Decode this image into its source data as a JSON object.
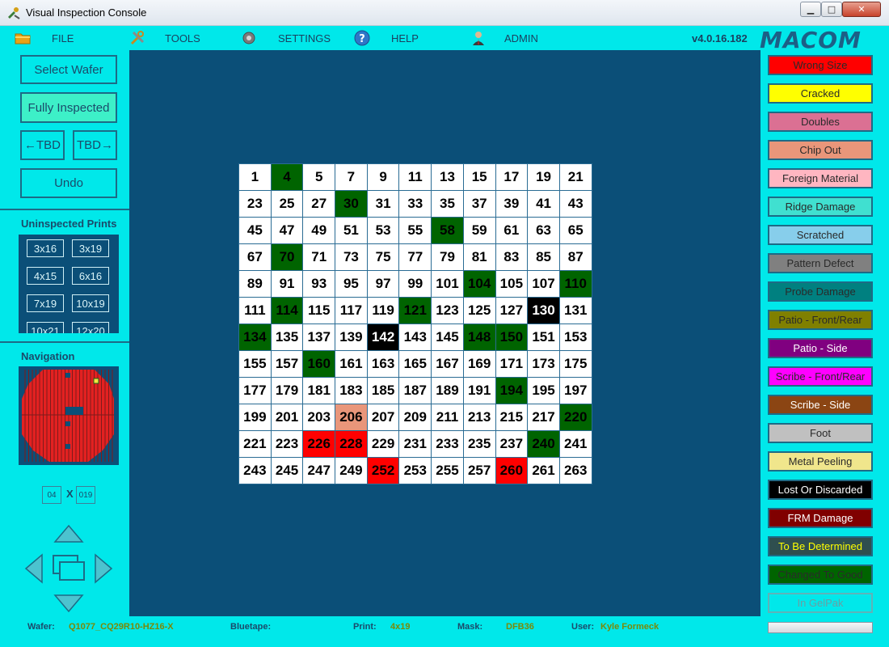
{
  "window": {
    "title": "Visual Inspection Console",
    "controls": {
      "minimize": "▁",
      "maximize": "□",
      "close": "✕"
    }
  },
  "menu": {
    "items": [
      {
        "label": "FILE",
        "icon": "folder-icon"
      },
      {
        "label": "TOOLS",
        "icon": "tools-icon"
      },
      {
        "label": "SETTINGS",
        "icon": "settings-icon"
      },
      {
        "label": "HELP",
        "icon": "help-icon"
      },
      {
        "label": "ADMIN",
        "icon": "admin-icon"
      }
    ],
    "version": "v4.0.16.182",
    "logo": "MACOM"
  },
  "left": {
    "select_wafer": "Select Wafer",
    "fully_inspected": "Fully Inspected",
    "prev_tbd": "←TBD",
    "next_tbd": "TBD→",
    "undo": "Undo",
    "uninspected_title": "Uninspected Prints",
    "prints": [
      "3x16",
      "3x19",
      "4x15",
      "6x16",
      "7x19",
      "10x19",
      "10x21",
      "12x20"
    ],
    "navigation_title": "Navigation",
    "coord_a": "04",
    "coord_x": "X",
    "coord_b": "019"
  },
  "grid": {
    "rows": [
      [
        "1",
        "4",
        "5",
        "7",
        "9",
        "11",
        "13",
        "15",
        "17",
        "19",
        "21"
      ],
      [
        "23",
        "25",
        "27",
        "30",
        "31",
        "33",
        "35",
        "37",
        "39",
        "41",
        "43"
      ],
      [
        "45",
        "47",
        "49",
        "51",
        "53",
        "55",
        "58",
        "59",
        "61",
        "63",
        "65"
      ],
      [
        "67",
        "70",
        "71",
        "73",
        "75",
        "77",
        "79",
        "81",
        "83",
        "85",
        "87"
      ],
      [
        "89",
        "91",
        "93",
        "95",
        "97",
        "99",
        "101",
        "104",
        "105",
        "107",
        "110"
      ],
      [
        "111",
        "114",
        "115",
        "117",
        "119",
        "121",
        "123",
        "125",
        "127",
        "130",
        "131"
      ],
      [
        "134",
        "135",
        "137",
        "139",
        "142",
        "143",
        "145",
        "148",
        "150",
        "151",
        "153"
      ],
      [
        "155",
        "157",
        "160",
        "161",
        "163",
        "165",
        "167",
        "169",
        "171",
        "173",
        "175"
      ],
      [
        "177",
        "179",
        "181",
        "183",
        "185",
        "187",
        "189",
        "191",
        "194",
        "195",
        "197"
      ],
      [
        "199",
        "201",
        "203",
        "206",
        "207",
        "209",
        "211",
        "213",
        "215",
        "217",
        "220"
      ],
      [
        "221",
        "223",
        "226",
        "228",
        "229",
        "231",
        "233",
        "235",
        "237",
        "240",
        "241"
      ],
      [
        "243",
        "245",
        "247",
        "249",
        "252",
        "253",
        "255",
        "257",
        "260",
        "261",
        "263"
      ]
    ],
    "marked": {
      "4": "Changed To Good",
      "30": "Changed To Good",
      "58": "Changed To Good",
      "70": "Changed To Good",
      "104": "Changed To Good",
      "110": "Changed To Good",
      "114": "Changed To Good",
      "121": "Changed To Good",
      "130": "Lost Or Discarded",
      "134": "Changed To Good",
      "142": "Lost Or Discarded",
      "148": "Changed To Good",
      "150": "Changed To Good",
      "160": "Changed To Good",
      "194": "Changed To Good",
      "206": "Chip Out",
      "220": "Changed To Good",
      "226": "Wrong Size",
      "228": "Wrong Size",
      "240": "Changed To Good",
      "252": "Wrong Size",
      "260": "Wrong Size"
    }
  },
  "legend": [
    {
      "label": "Wrong Size",
      "bg": "#ff0000",
      "fg": "#2a2a2a"
    },
    {
      "label": "Cracked",
      "bg": "#ffff00",
      "fg": "#2a2a2a"
    },
    {
      "label": "Doubles",
      "bg": "#db7093",
      "fg": "#2a2a2a"
    },
    {
      "label": "Chip Out",
      "bg": "#e9967a",
      "fg": "#2a2a2a"
    },
    {
      "label": "Foreign Material",
      "bg": "#ffb6c1",
      "fg": "#2a2a2a"
    },
    {
      "label": "Ridge Damage",
      "bg": "#40e0d0",
      "fg": "#2a2a2a"
    },
    {
      "label": "Scratched",
      "bg": "#87ceeb",
      "fg": "#2a2a2a"
    },
    {
      "label": "Pattern Defect",
      "bg": "#808080",
      "fg": "#2a2a2a"
    },
    {
      "label": "Probe Damage",
      "bg": "#008080",
      "fg": "#2a2a2a"
    },
    {
      "label": "Patio - Front/Rear",
      "bg": "#808000",
      "fg": "#2a2a2a"
    },
    {
      "label": "Patio - Side",
      "bg": "#800080",
      "fg": "#ffffff"
    },
    {
      "label": "Scribe - Front/Rear",
      "bg": "#ff00ff",
      "fg": "#2a2a2a"
    },
    {
      "label": "Scribe - Side",
      "bg": "#8b4513",
      "fg": "#ffffff"
    },
    {
      "label": "Foot",
      "bg": "#c0c0c0",
      "fg": "#2a2a2a"
    },
    {
      "label": "Metal Peeling",
      "bg": "#f0e68c",
      "fg": "#2a2a2a"
    },
    {
      "label": "Lost Or Discarded",
      "bg": "#000000",
      "fg": "#ffffff"
    },
    {
      "label": "FRM Damage",
      "bg": "#800000",
      "fg": "#ffffff"
    },
    {
      "label": "To Be Determined",
      "bg": "#2f4f4f",
      "fg": "#ffff00"
    },
    {
      "label": "Changed To Good",
      "bg": "#006400",
      "fg": "#2a2a2a"
    },
    {
      "label": "In GelPak",
      "bg": "#00e8ea",
      "fg": "#6a9fa3"
    }
  ],
  "status": {
    "wafer_label": "Wafer:",
    "wafer_value": "Q1077_CQ29R10-HZ16-X",
    "bluetape_label": "Bluetape:",
    "bluetape_value": "",
    "print_label": "Print:",
    "print_value": "4x19",
    "mask_label": "Mask:",
    "mask_value": "DFB36",
    "user_label": "User:",
    "user_value": "Kyle Formeck"
  }
}
